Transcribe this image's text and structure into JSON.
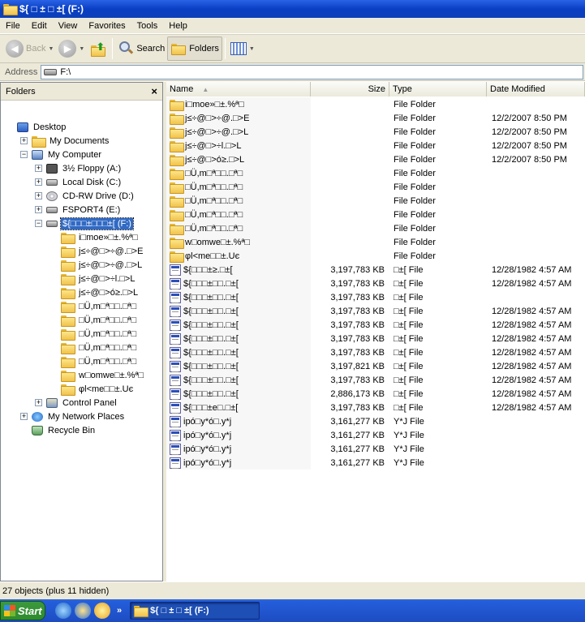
{
  "window": {
    "title": "${ □ ± □ ±[ (F:)"
  },
  "menu": [
    "File",
    "Edit",
    "View",
    "Favorites",
    "Tools",
    "Help"
  ],
  "toolbar": {
    "back": "Back",
    "search": "Search",
    "folders": "Folders"
  },
  "address": {
    "label": "Address",
    "value": "F:\\"
  },
  "folders_pane": {
    "title": "Folders",
    "close": "×",
    "tree": [
      {
        "label": "Desktop",
        "indent": 0,
        "exp": "",
        "icon": "desktop-icon"
      },
      {
        "label": "My Documents",
        "indent": 1,
        "exp": "+",
        "icon": "folder-icon"
      },
      {
        "label": "My Computer",
        "indent": 1,
        "exp": "−",
        "icon": "computer-icon"
      },
      {
        "label": "3½ Floppy (A:)",
        "indent": 2,
        "exp": "+",
        "icon": "floppy-icon"
      },
      {
        "label": "Local Disk (C:)",
        "indent": 2,
        "exp": "+",
        "icon": "disk-icon"
      },
      {
        "label": "CD-RW Drive (D:)",
        "indent": 2,
        "exp": "+",
        "icon": "cd-icon"
      },
      {
        "label": "FSPORT4 (E:)",
        "indent": 2,
        "exp": "+",
        "icon": "disk-icon"
      },
      {
        "label": "${□□□±□□□±[ (F:)",
        "indent": 2,
        "exp": "−",
        "icon": "disk-icon",
        "selected": true
      },
      {
        "label": "i□moe»□±.%ª□",
        "indent": 3,
        "exp": "",
        "icon": "folder-icon"
      },
      {
        "label": "j≤÷@□>÷@.□>E",
        "indent": 3,
        "exp": "",
        "icon": "folder-icon"
      },
      {
        "label": "j≤÷@□>÷@.□>L",
        "indent": 3,
        "exp": "",
        "icon": "folder-icon"
      },
      {
        "label": "j≤÷@□>÷l.□>L",
        "indent": 3,
        "exp": "",
        "icon": "folder-icon"
      },
      {
        "label": "j≤÷@□>ó≥.□>L",
        "indent": 3,
        "exp": "",
        "icon": "folder-icon"
      },
      {
        "label": "□Ü,m□ª□□.□ª□",
        "indent": 3,
        "exp": "",
        "icon": "folder-icon"
      },
      {
        "label": "□Ü,m□ª□□.□ª□",
        "indent": 3,
        "exp": "",
        "icon": "folder-icon"
      },
      {
        "label": "□Ü,m□ª□□.□ª□",
        "indent": 3,
        "exp": "",
        "icon": "folder-icon"
      },
      {
        "label": "□Ü,m□ª□□.□ª□",
        "indent": 3,
        "exp": "",
        "icon": "folder-icon"
      },
      {
        "label": "□Ü,m□ª□□.□ª□",
        "indent": 3,
        "exp": "",
        "icon": "folder-icon"
      },
      {
        "label": "w□omwe□±.%ª□",
        "indent": 3,
        "exp": "",
        "icon": "folder-icon"
      },
      {
        "label": "φl<me□□±.Uє",
        "indent": 3,
        "exp": "",
        "icon": "folder-icon"
      },
      {
        "label": "Control Panel",
        "indent": 2,
        "exp": "+",
        "icon": "control-panel-icon"
      },
      {
        "label": "My Network Places",
        "indent": 1,
        "exp": "+",
        "icon": "network-icon"
      },
      {
        "label": "Recycle Bin",
        "indent": 1,
        "exp": "",
        "icon": "recycle-bin-icon"
      }
    ]
  },
  "columns": {
    "name": "Name",
    "size": "Size",
    "type": "Type",
    "date": "Date Modified"
  },
  "files": [
    {
      "name": "i□moe»□±.%ª□",
      "size": "",
      "type": "File Folder",
      "date": "",
      "kind": "folder"
    },
    {
      "name": "j≤÷@□>÷@.□>E",
      "size": "",
      "type": "File Folder",
      "date": "12/2/2007 8:50 PM",
      "kind": "folder"
    },
    {
      "name": "j≤÷@□>÷@.□>L",
      "size": "",
      "type": "File Folder",
      "date": "12/2/2007 8:50 PM",
      "kind": "folder"
    },
    {
      "name": "j≤÷@□>÷l.□>L",
      "size": "",
      "type": "File Folder",
      "date": "12/2/2007 8:50 PM",
      "kind": "folder"
    },
    {
      "name": "j≤÷@□>ó≥.□>L",
      "size": "",
      "type": "File Folder",
      "date": "12/2/2007 8:50 PM",
      "kind": "folder"
    },
    {
      "name": "□Ü,m□ª□□.□ª□",
      "size": "",
      "type": "File Folder",
      "date": "",
      "kind": "folder"
    },
    {
      "name": "□Ü,m□ª□□.□ª□",
      "size": "",
      "type": "File Folder",
      "date": "",
      "kind": "folder"
    },
    {
      "name": "□Ü,m□ª□□.□ª□",
      "size": "",
      "type": "File Folder",
      "date": "",
      "kind": "folder"
    },
    {
      "name": "□Ü,m□ª□□.□ª□",
      "size": "",
      "type": "File Folder",
      "date": "",
      "kind": "folder"
    },
    {
      "name": "□Ü,m□ª□□.□ª□",
      "size": "",
      "type": "File Folder",
      "date": "",
      "kind": "folder"
    },
    {
      "name": "w□omwe□±.%ª□",
      "size": "",
      "type": "File Folder",
      "date": "",
      "kind": "folder"
    },
    {
      "name": "φl<me□□±.Uє",
      "size": "",
      "type": "File Folder",
      "date": "",
      "kind": "folder"
    },
    {
      "name": "${□□□±≥.□±[",
      "size": "3,197,783 KB",
      "type": "□±[ File",
      "date": "12/28/1982 4:57 AM",
      "kind": "file"
    },
    {
      "name": "${□□□±□□.□±[",
      "size": "3,197,783 KB",
      "type": "□±[ File",
      "date": "12/28/1982 4:57 AM",
      "kind": "file"
    },
    {
      "name": "${□□□±□□.□±[",
      "size": "3,197,783 KB",
      "type": "□±[ File",
      "date": "",
      "kind": "file"
    },
    {
      "name": "${□□□±□□.□±[",
      "size": "3,197,783 KB",
      "type": "□±[ File",
      "date": "12/28/1982 4:57 AM",
      "kind": "file"
    },
    {
      "name": "${□□□±□□.□±[",
      "size": "3,197,783 KB",
      "type": "□±[ File",
      "date": "12/28/1982 4:57 AM",
      "kind": "file"
    },
    {
      "name": "${□□□±□□.□±[",
      "size": "3,197,783 KB",
      "type": "□±[ File",
      "date": "12/28/1982 4:57 AM",
      "kind": "file"
    },
    {
      "name": "${□□□±□□.□±[",
      "size": "3,197,783 KB",
      "type": "□±[ File",
      "date": "12/28/1982 4:57 AM",
      "kind": "file"
    },
    {
      "name": "${□□□±□□.□±[",
      "size": "3,197,821 KB",
      "type": "□±[ File",
      "date": "12/28/1982 4:57 AM",
      "kind": "file"
    },
    {
      "name": "${□□□±□□.□±[",
      "size": "3,197,783 KB",
      "type": "□±[ File",
      "date": "12/28/1982 4:57 AM",
      "kind": "file"
    },
    {
      "name": "${□□□±□□.□±[",
      "size": "2,886,173 KB",
      "type": "□±[ File",
      "date": "12/28/1982 4:57 AM",
      "kind": "file"
    },
    {
      "name": "${□□□±e□.□±[",
      "size": "3,197,783 KB",
      "type": "□±[ File",
      "date": "12/28/1982 4:57 AM",
      "kind": "file"
    },
    {
      "name": "ipó□y*ó□.y*j",
      "size": "3,161,277 KB",
      "type": "Y*J File",
      "date": "",
      "kind": "file"
    },
    {
      "name": "ipó□y*ó□.y*j",
      "size": "3,161,277 KB",
      "type": "Y*J File",
      "date": "",
      "kind": "file"
    },
    {
      "name": "ipó□y*ó□.y*j",
      "size": "3,161,277 KB",
      "type": "Y*J File",
      "date": "",
      "kind": "file"
    },
    {
      "name": "ipó□y*ó□.y*j",
      "size": "3,161,277 KB",
      "type": "Y*J File",
      "date": "",
      "kind": "file"
    }
  ],
  "status": "27 objects (plus 11 hidden)",
  "taskbar": {
    "start": "Start",
    "chevron": "»",
    "task": "${ □ ± □ ±[ (F:)"
  }
}
